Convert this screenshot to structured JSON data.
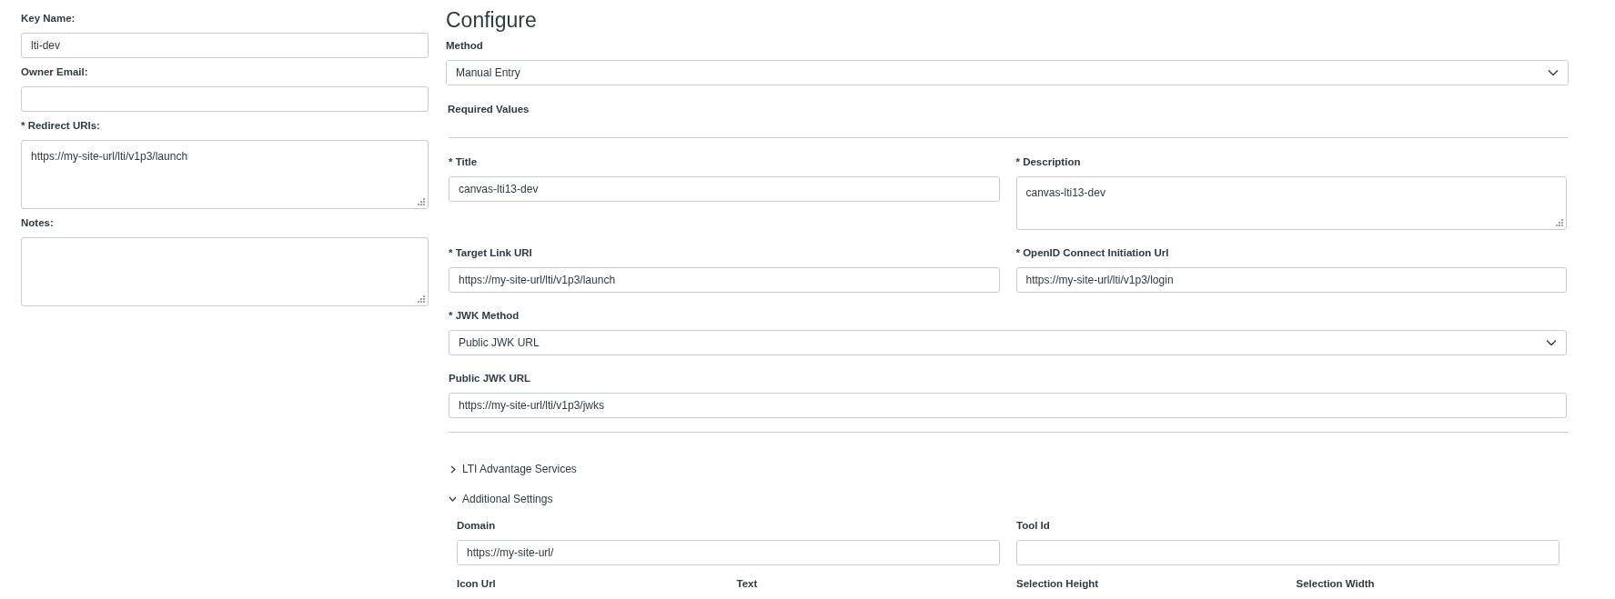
{
  "key_form": {
    "fields": [
      {
        "label": "Key Name:",
        "kind": "input",
        "value": "lti-dev"
      },
      {
        "label": "Owner Email:",
        "kind": "input"
      },
      {
        "label": "* Redirect URIs:",
        "kind": "textarea",
        "value": "https://my-site-url/lti/v1p3/launch"
      },
      {
        "label": "Notes:",
        "kind": "textarea"
      }
    ]
  },
  "configure": {
    "heading": "Configure",
    "method": {
      "label": "Method",
      "kind": "select",
      "value": "Manual Entry"
    },
    "section_title": "Required Values",
    "rows": [
      [
        {
          "label": "* Title",
          "kind": "input",
          "value": "canvas-lti13-dev"
        },
        {
          "label": "* Description",
          "kind": "textarea",
          "value": "canvas-lti13-dev"
        }
      ],
      [
        {
          "label": "* Target Link URI",
          "kind": "input",
          "value": "https://my-site-url/lti/v1p3/launch"
        },
        {
          "label": "* OpenID Connect Initiation Url",
          "kind": "input",
          "value": "https://my-site-url/lti/v1p3/login"
        }
      ],
      [
        {
          "label": "* JWK Method",
          "kind": "select",
          "value": "Public JWK URL"
        }
      ],
      [
        {
          "label": "Public JWK URL",
          "kind": "input",
          "value": "https://my-site-url/lti/v1p3/jwks"
        }
      ]
    ],
    "sections": [
      {
        "label": "LTI Advantage Services",
        "expanded": false
      },
      {
        "label": "Additional Settings",
        "expanded": true,
        "fields": [
          {
            "label": "Domain",
            "kind": "input",
            "value": "https://my-site-url/"
          },
          {
            "label": "Tool Id",
            "kind": "input"
          }
        ],
        "placement_labels": [
          "Icon Url",
          "Text",
          "Selection Height",
          "Selection Width"
        ]
      }
    ]
  }
}
